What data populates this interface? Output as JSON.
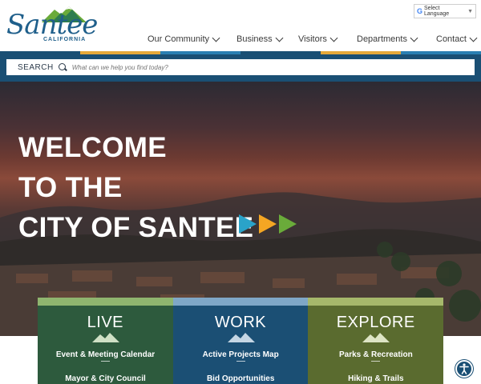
{
  "brand": {
    "name": "Santee",
    "subtitle": "CALIFORNIA"
  },
  "language": {
    "label": "Select Language",
    "icon": "google-g-icon"
  },
  "nav": {
    "items": [
      {
        "label": "Our Community"
      },
      {
        "label": "Business"
      },
      {
        "label": "Visitors"
      },
      {
        "label": "Departments"
      },
      {
        "label": "Contact"
      }
    ]
  },
  "search": {
    "label": "SEARCH",
    "placeholder": "What can we help you find today?"
  },
  "hero": {
    "lines": [
      "WELCOME",
      "TO THE",
      "CITY OF SANTEE"
    ],
    "arrow_colors": [
      "#2aa3c9",
      "#f5a623",
      "#6aab3a"
    ]
  },
  "cards": [
    {
      "title": "LIVE",
      "links": [
        "Event & Meeting Calendar",
        "Mayor & City Council"
      ],
      "color": "#2d5a3d",
      "accent": "#8fb56f"
    },
    {
      "title": "WORK",
      "links": [
        "Active Projects Map",
        "Bid Opportunities"
      ],
      "color": "#1b4f74",
      "accent": "#7fa7c7"
    },
    {
      "title": "EXPLORE",
      "links": [
        "Parks & Recreation",
        "Hiking & Trails"
      ],
      "color": "#5a6b2f",
      "accent": "#a6b86b"
    }
  ],
  "colors": {
    "brand_blue": "#1f5f8b",
    "search_band": "#1a4f74",
    "bar_green": "#6aab3a",
    "bar_blue": "#2a7fb2",
    "bar_gold": "#e6a93a"
  }
}
